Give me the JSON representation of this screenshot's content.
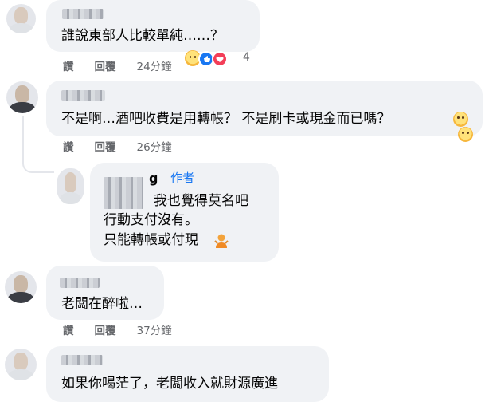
{
  "comments": [
    {
      "text": "誰說東部人比較單純……？",
      "actions": {
        "like": "讚",
        "reply": "回覆",
        "time": "24分鐘"
      },
      "reaction_count": "4"
    },
    {
      "text": "不是啊…酒吧收費是用轉帳？ 不是刷卡或現金而已嗎？",
      "actions": {
        "like": "讚",
        "reply": "回覆",
        "time": "26分鐘"
      }
    },
    {
      "name_suffix": "g",
      "badge": "作者",
      "lines": [
        "我也覺得莫名吧",
        "行動支付沒有。",
        "只能轉帳或付現"
      ]
    },
    {
      "text": "老闆在醉啦…",
      "actions": {
        "like": "讚",
        "reply": "回覆",
        "time": "37分鐘"
      }
    },
    {
      "text": "如果你喝茫了，老闆收入就財源廣進"
    }
  ],
  "colors": {
    "bubble": "#f0f2f5",
    "meta": "#65676b",
    "badge": "#1877f2",
    "like_blue": "#1877f2",
    "love_red": "#f33e58"
  }
}
